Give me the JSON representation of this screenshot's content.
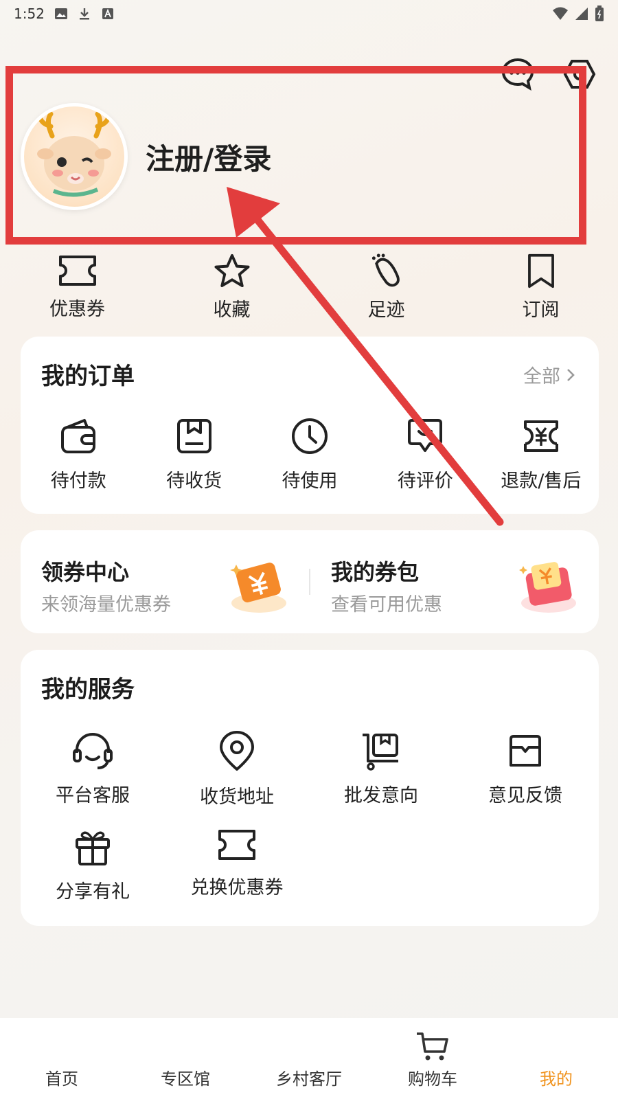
{
  "status_bar": {
    "time": "1:52"
  },
  "profile": {
    "login_label": "注册/登录"
  },
  "quick_links": [
    {
      "label": "优惠券",
      "icon": "ticket-icon"
    },
    {
      "label": "收藏",
      "icon": "star-icon"
    },
    {
      "label": "足迹",
      "icon": "footprint-icon"
    },
    {
      "label": "订阅",
      "icon": "bookmark-icon"
    }
  ],
  "orders": {
    "title": "我的订单",
    "see_all": "全部",
    "items": [
      {
        "label": "待付款",
        "icon": "wallet-icon"
      },
      {
        "label": "待收货",
        "icon": "package-icon"
      },
      {
        "label": "待使用",
        "icon": "clock-icon"
      },
      {
        "label": "待评价",
        "icon": "review-icon"
      },
      {
        "label": "退款/售后",
        "icon": "refund-icon"
      }
    ]
  },
  "coupons": {
    "center": {
      "title": "领券中心",
      "subtitle": "来领海量优惠券"
    },
    "wallet": {
      "title": "我的券包",
      "subtitle": "查看可用优惠"
    }
  },
  "services": {
    "title": "我的服务",
    "items": [
      {
        "label": "平台客服",
        "icon": "headset-icon"
      },
      {
        "label": "收货地址",
        "icon": "location-icon"
      },
      {
        "label": "批发意向",
        "icon": "cart-box-icon"
      },
      {
        "label": "意见反馈",
        "icon": "feedback-icon"
      },
      {
        "label": "分享有礼",
        "icon": "gift-icon"
      },
      {
        "label": "兑换优惠券",
        "icon": "ticket-icon"
      }
    ]
  },
  "tabbar": {
    "tabs": [
      {
        "label": "首页"
      },
      {
        "label": "专区馆"
      },
      {
        "label": "乡村客厅"
      },
      {
        "label": "购物车"
      },
      {
        "label": "我的"
      }
    ],
    "active_color": "#f0931e"
  },
  "colors": {
    "annotation": "#e23d3d",
    "accent": "#f0931e"
  }
}
